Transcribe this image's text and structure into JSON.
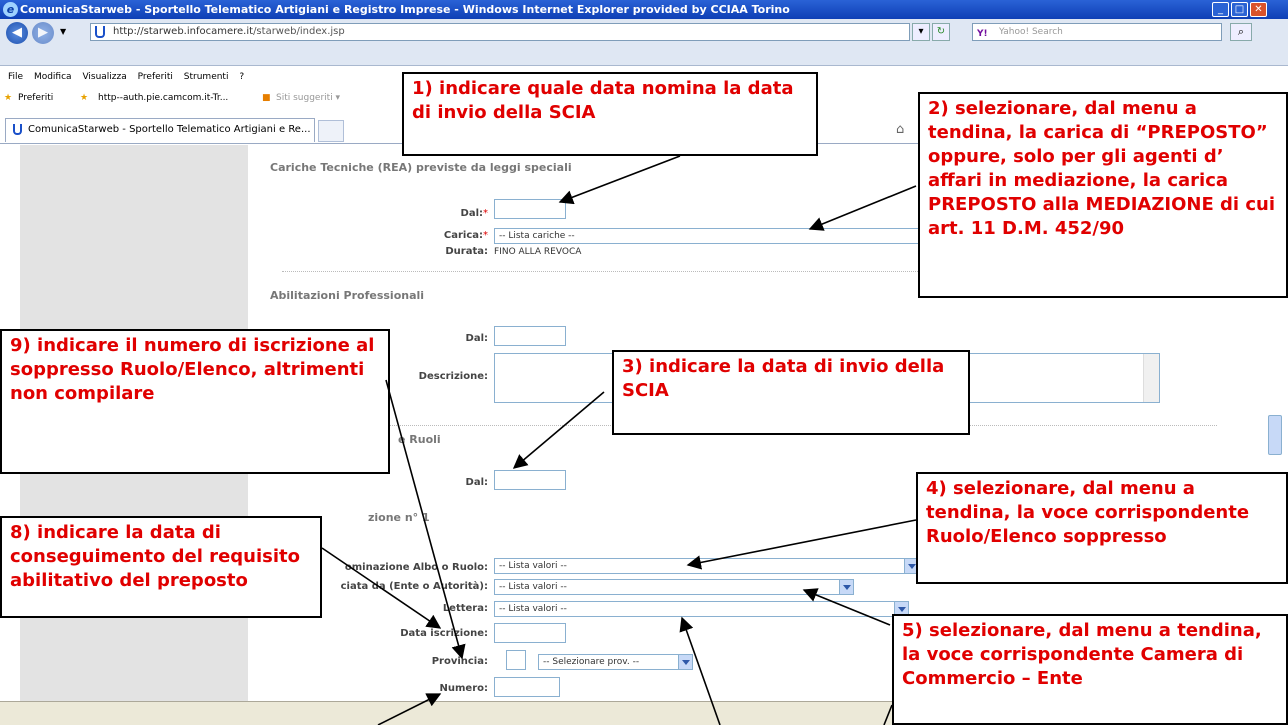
{
  "window": {
    "title": "ComunicaStarweb - Sportello Telematico Artigiani e Registro Imprese - Windows Internet Explorer provided by CCIAA Torino",
    "buttons": [
      "minimize-icon",
      "maximize-icon",
      "close-icon"
    ]
  },
  "address": {
    "url_domain": "http://starweb.infocamere.it",
    "url_path": "/starweb/index.jsp",
    "search_placeholder": "Yahoo! Search",
    "search_brand": "Y!"
  },
  "menu": [
    "File",
    "Modifica",
    "Visualizza",
    "Preferiti",
    "Strumenti",
    "?"
  ],
  "favorites": {
    "label": "Preferiti",
    "items": [
      "http--auth.pie.camcom.it-Tr...",
      "Siti suggeriti ▾"
    ]
  },
  "tab": {
    "label": "ComunicaStarweb - Sportello Telematico Artigiani e Re..."
  },
  "form": {
    "sec_cariche": "Cariche Tecniche (REA) previste da leggi speciali",
    "dal_label": "Dal:",
    "carica_label": "Carica:",
    "carica_value": "-- Lista cariche --",
    "durata_label": "Durata:",
    "durata_value": "FINO ALLA REVOCA",
    "sec_abilitazioni": "Abilitazioni Professionali",
    "descrizione_label": "Descrizione:",
    "sec_albi": "e Ruoli",
    "sec_iscrizione": "zione n° 1",
    "denominazione_label": "ominazione Albo o Ruolo:",
    "rilasciata_label": "ciata da (Ente o Autorità):",
    "lettera_label": "Lettera:",
    "data_iscrizione_label": "Data iscrizione:",
    "provincia_label": "Provincia:",
    "numero_label": "Numero:",
    "lista_valori": "-- Lista valori --",
    "selezionare_prov": "-- Selezionare prov. --"
  },
  "callouts": {
    "c1": "1) indicare quale data nomina la data di invio della SCIA",
    "c2": "2) selezionare, dal menu a tendina, la carica di “PREPOSTO” oppure, solo per gli agenti d’ affari in mediazione, la carica PREPOSTO alla MEDIAZIONE di cui art. 11 D.M. 452/90",
    "c3": "3) indicare la data di invio della SCIA",
    "c4": "4) selezionare, dal menu a tendina, la voce corrispondente Ruolo/Elenco soppresso",
    "c5": "5) selezionare, dal menu a tendina, la voce corrispondente Camera di Commercio – Ente",
    "c8": "8) indicare la data di conseguimento del requisito abilitativo del preposto",
    "c9": "9) indicare il numero di iscrizione al soppresso Ruolo/Elenco, altrimenti non compilare"
  },
  "colors": {
    "callout_text": "#e00000",
    "titlebar": "#0e3fb5",
    "sidebar": "#e3e3e3"
  }
}
